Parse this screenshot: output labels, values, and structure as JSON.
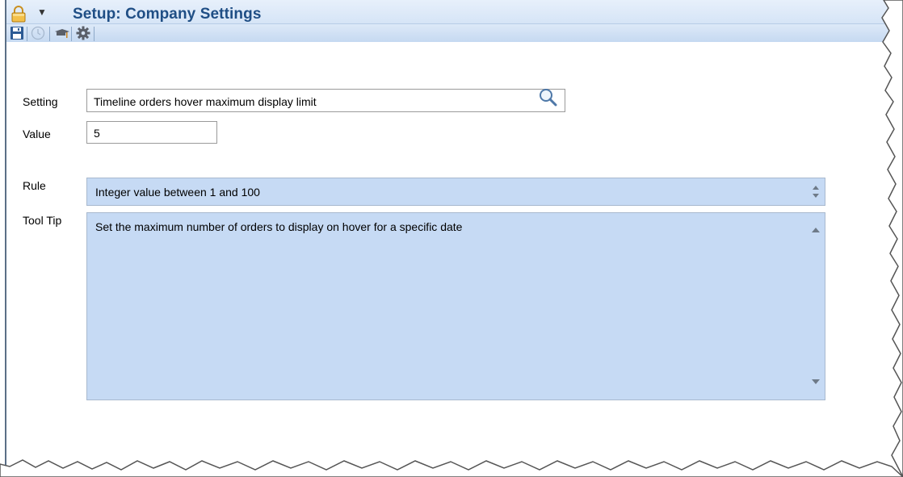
{
  "window": {
    "title": "Setup: Company Settings"
  },
  "toolbar": {
    "tools": [
      {
        "icon": "save-icon"
      },
      {
        "icon": "clock-icon"
      },
      {
        "icon": "graduation-cap-icon"
      },
      {
        "icon": "gear-icon"
      }
    ]
  },
  "form": {
    "setting": {
      "label": "Setting",
      "value": "Timeline orders hover maximum display limit",
      "search_icon": "search-icon"
    },
    "value": {
      "label": "Value",
      "value": "5"
    },
    "rule": {
      "label": "Rule",
      "text": "Integer value between 1 and 100"
    },
    "tooltip": {
      "label": "Tool Tip",
      "text": "Set the maximum number of orders to display on hover for a specific date"
    }
  },
  "colors": {
    "title": "#1f4e85",
    "readonly_bg": "#c6daf4",
    "toolbar_bg": "#c5d9f1"
  }
}
